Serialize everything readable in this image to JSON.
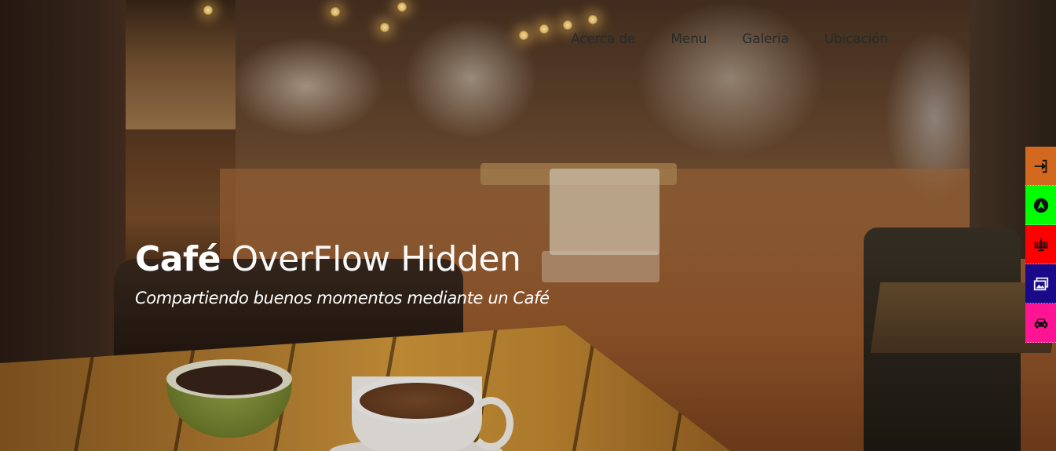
{
  "nav": {
    "items": [
      {
        "label": "Acerca de"
      },
      {
        "label": "Menu"
      },
      {
        "label": "Galeria"
      },
      {
        "label": "Ubicación"
      }
    ]
  },
  "hero": {
    "title_bold": "Café",
    "title_rest": "OverFlow Hidden",
    "subtitle": "Compartiendo buenos momentos mediante un Café"
  },
  "side_buttons": [
    {
      "icon": "sign-in-icon",
      "color": "#d2691e"
    },
    {
      "icon": "navigation-arrow-icon",
      "color": "#00ff00"
    },
    {
      "icon": "menorah-icon",
      "color": "#ff0000"
    },
    {
      "icon": "images-icon",
      "color": "#1a0a8a"
    },
    {
      "icon": "car-icon",
      "color": "#ff1493"
    }
  ]
}
